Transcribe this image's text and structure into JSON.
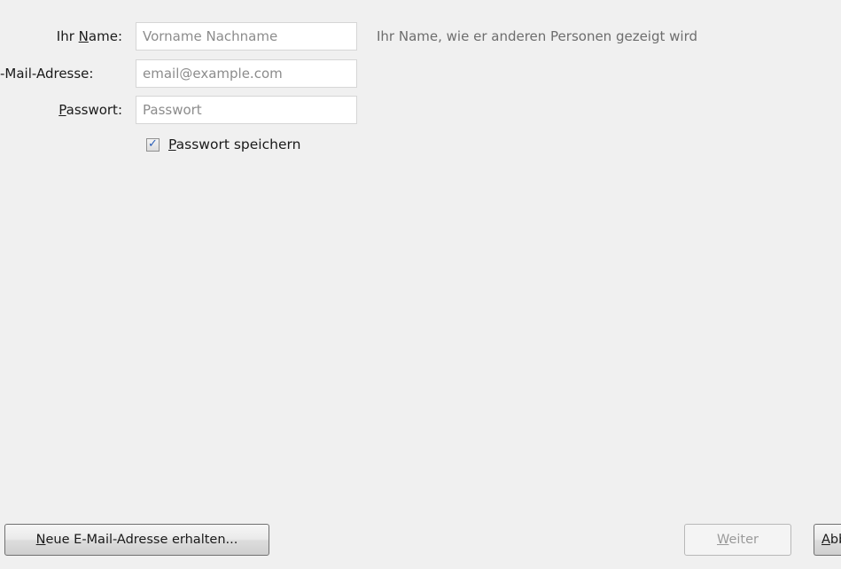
{
  "form": {
    "name": {
      "label_pre": "Ihr ",
      "label_mnemonic": "N",
      "label_post": "ame:",
      "placeholder": "Vorname Nachname",
      "value": "",
      "hint": "Ihr Name, wie er anderen Personen gezeigt wird"
    },
    "email": {
      "label": "-Mail-Adresse:",
      "placeholder": "email@example.com",
      "value": ""
    },
    "password": {
      "label_mnemonic": "P",
      "label_post": "asswort:",
      "placeholder": "Passwort",
      "value": ""
    },
    "remember_password": {
      "checked": true,
      "label_mnemonic": "P",
      "label_post": "asswort speichern"
    }
  },
  "footer": {
    "new_address_button": {
      "label_mnemonic": "N",
      "label_post": "eue E-Mail-Adresse erhalten..."
    },
    "next_button": {
      "label_mnemonic": "W",
      "label_post": "eiter",
      "disabled": true
    },
    "abort_button": {
      "label_mnemonic": "A",
      "label_post": "bbrechen"
    }
  }
}
